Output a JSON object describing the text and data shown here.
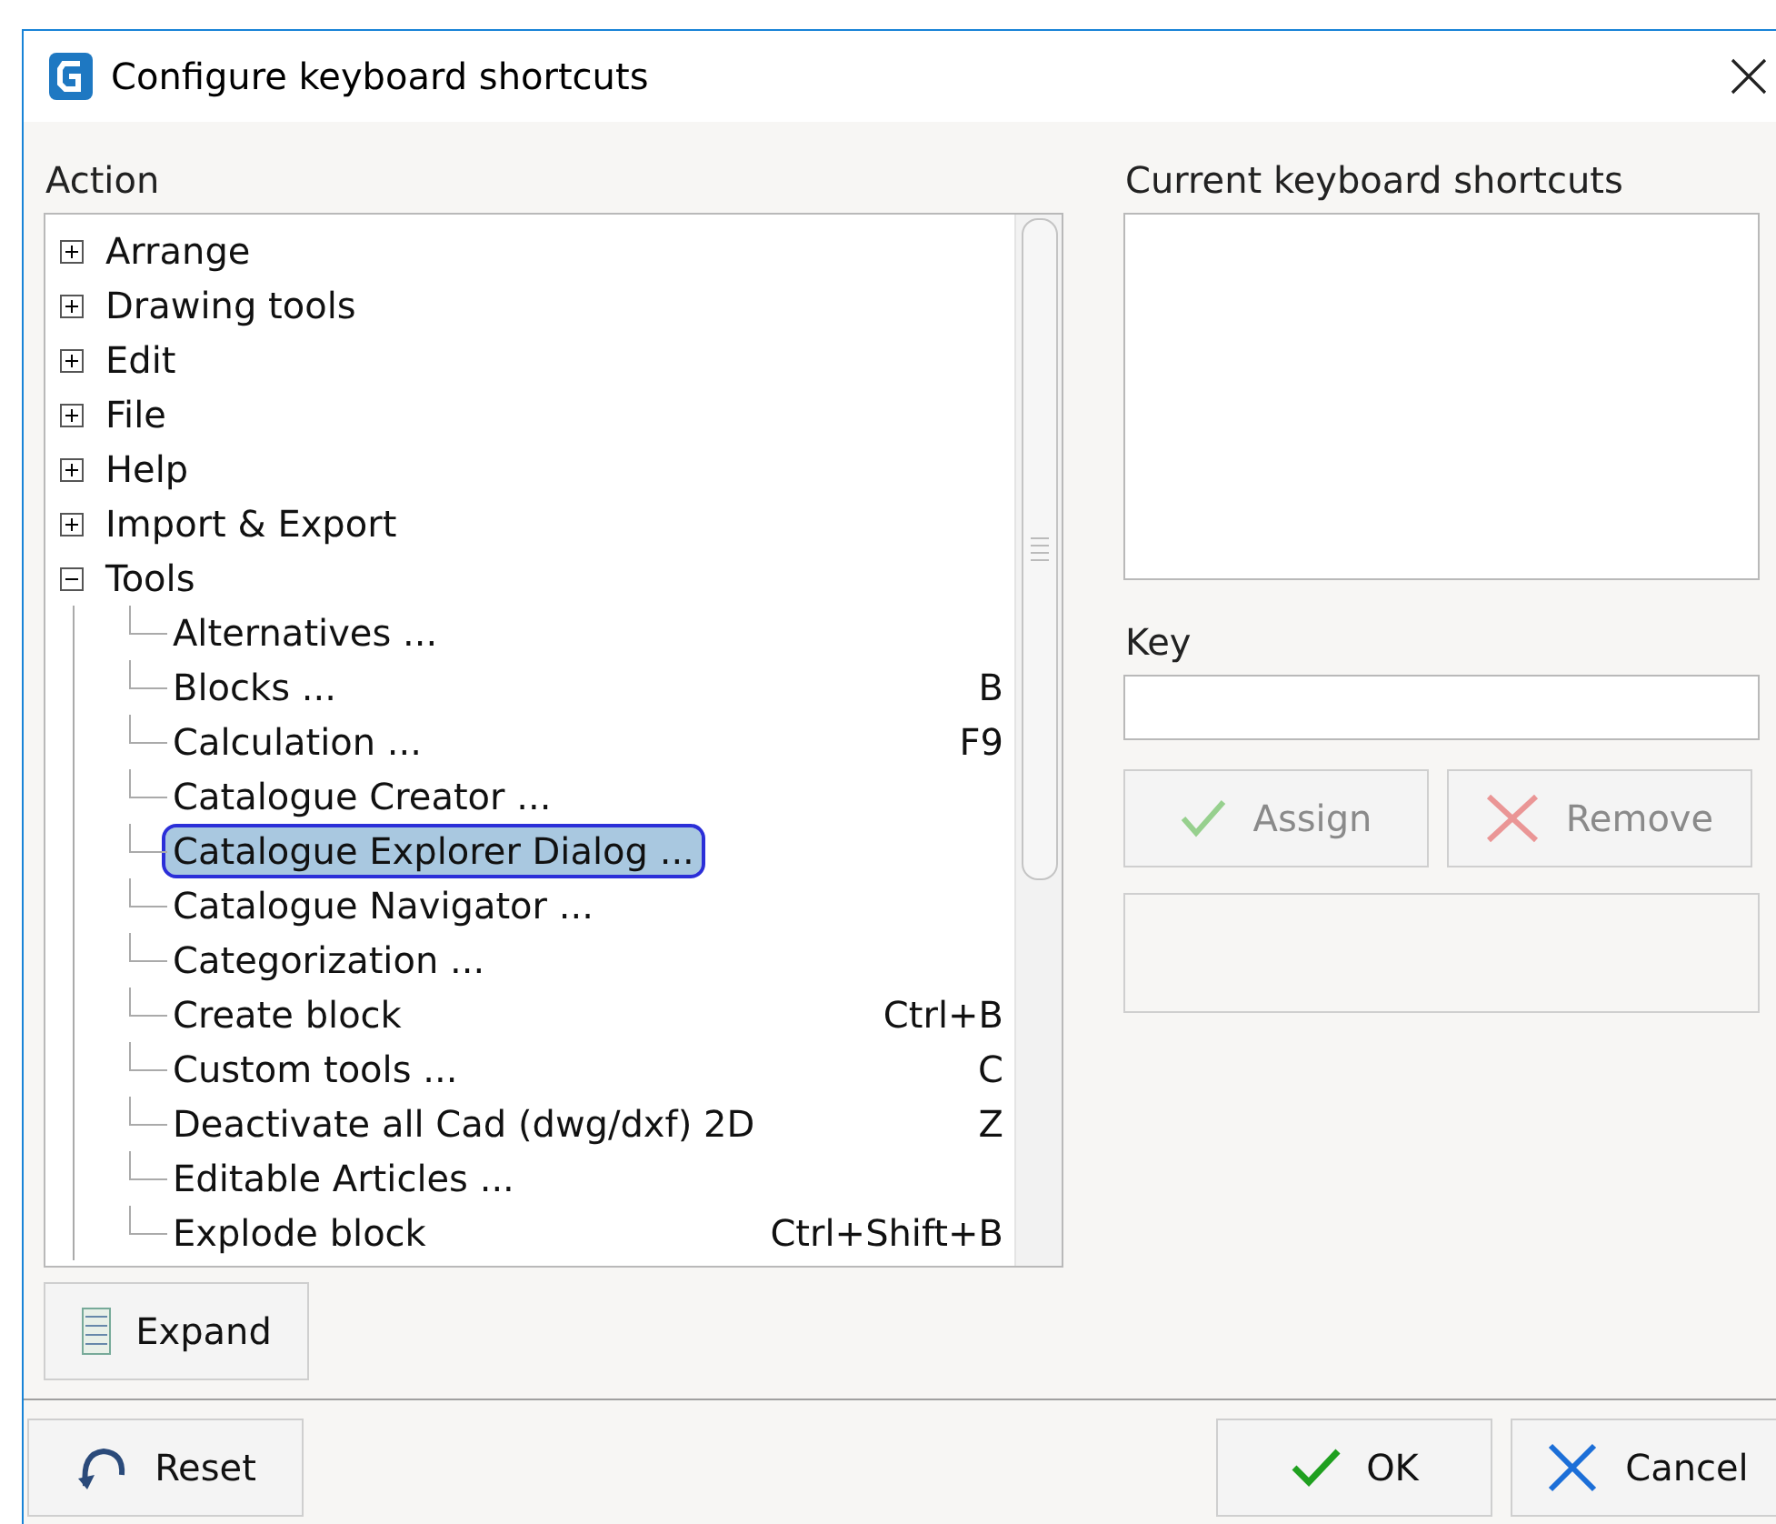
{
  "window": {
    "title": "Configure keyboard shortcuts"
  },
  "action_label": "Action",
  "tree": [
    {
      "label": "Arrange",
      "expanded": false
    },
    {
      "label": "Drawing tools",
      "expanded": false
    },
    {
      "label": "Edit",
      "expanded": false
    },
    {
      "label": "File",
      "expanded": false
    },
    {
      "label": "Help",
      "expanded": false
    },
    {
      "label": "Import & Export",
      "expanded": false
    },
    {
      "label": "Tools",
      "expanded": true,
      "children": [
        {
          "label": "Alternatives ...",
          "selected": false
        },
        {
          "label": "Blocks ...",
          "shortcut": "B",
          "selected": false
        },
        {
          "label": "Calculation ...",
          "shortcut": "F9",
          "selected": false
        },
        {
          "label": "Catalogue Creator ...",
          "selected": false
        },
        {
          "label": "Catalogue Explorer Dialog ...",
          "selected": true
        },
        {
          "label": "Catalogue Navigator ...",
          "selected": false
        },
        {
          "label": "Categorization ...",
          "selected": false
        },
        {
          "label": "Create block",
          "shortcut": "Ctrl+B",
          "selected": false
        },
        {
          "label": "Custom tools ...",
          "shortcut": "C",
          "selected": false
        },
        {
          "label": "Deactivate all Cad (dwg/dxf) 2D",
          "shortcut": "Z",
          "selected": false
        },
        {
          "label": "Editable Articles ...",
          "selected": false
        },
        {
          "label": "Explode block",
          "shortcut": "Ctrl+Shift+B",
          "selected": false
        }
      ]
    }
  ],
  "expand_button": "Expand",
  "current_label": "Current keyboard shortcuts",
  "key_label": "Key",
  "assign_button": {
    "label": "Assign",
    "disabled": true
  },
  "remove_button": {
    "label": "Remove",
    "disabled": true
  },
  "footer": {
    "reset": "Reset",
    "ok": "OK",
    "cancel": "Cancel"
  }
}
